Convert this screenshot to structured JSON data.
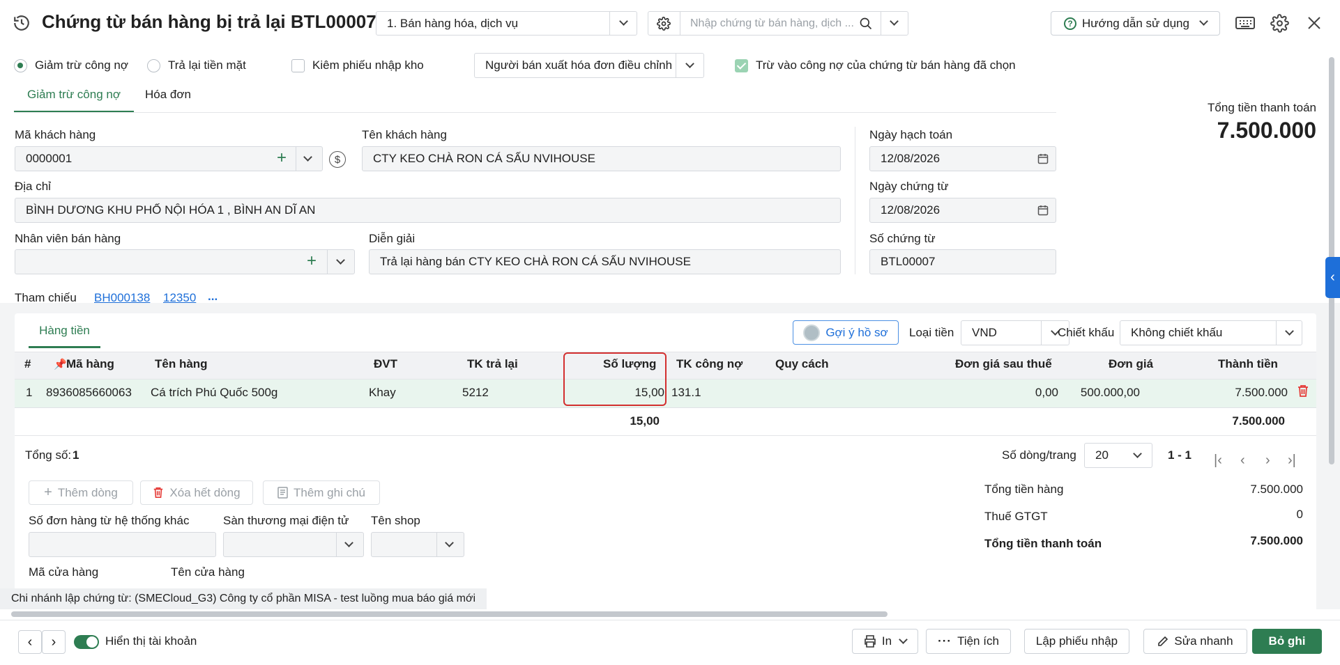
{
  "header": {
    "title": "Chứng từ bán hàng bị trả lại BTL00007",
    "type_select": "1. Bán hàng hóa, dịch vụ",
    "search_placeholder": "Nhập chứng từ bán hàng, dịch ...",
    "help_label": "Hướng dẫn sử dụng"
  },
  "options": {
    "radio_deduct": "Giảm trừ công nợ",
    "radio_refund": "Trả lại tiền mặt",
    "check_stock": "Kiêm phiếu nhập kho",
    "invoice_select": "Người bán xuất hóa đơn điều chỉnh",
    "check_offset": "Trừ vào công nợ của chứng từ bán hàng đã chọn"
  },
  "tabs": [
    "Giảm trừ công nợ",
    "Hóa đơn"
  ],
  "total_box": {
    "label": "Tổng tiền thanh toán",
    "value": "7.500.000"
  },
  "form": {
    "customer_code_label": "Mã khách hàng",
    "customer_code": "0000001",
    "customer_name_label": "Tên khách hàng",
    "customer_name": "CTY KEO CHÀ RON  CÁ SẤU NVIHOUSE",
    "address_label": "Địa chỉ",
    "address": "BÌNH DƯƠNG KHU PHỐ NỘI HÓA 1 , BÌNH AN DĨ AN",
    "sales_staff_label": "Nhân viên bán hàng",
    "sales_staff": "",
    "description_label": "Diễn giải",
    "description": "Trả lại hàng bán CTY KEO CHÀ RON  CÁ SẤU NVIHOUSE",
    "posting_date_label": "Ngày hạch toán",
    "posting_date": "12/08/2026",
    "voucher_date_label": "Ngày chứng từ",
    "voucher_date": "12/08/2026",
    "voucher_no_label": "Số chứng từ",
    "voucher_no": "BTL00007",
    "reference_label": "Tham chiếu",
    "ref1": "BH000138",
    "ref2": "12350",
    "ref_more": "..."
  },
  "goods": {
    "tab": "Hàng tiền",
    "suggest_btn": "Gợi ý hồ sơ",
    "currency_label": "Loại tiền",
    "currency": "VND",
    "discount_label": "Chiết khấu",
    "discount": "Không chiết khấu",
    "columns": [
      "#",
      "Mã hàng",
      "Tên hàng",
      "ĐVT",
      "TK trả lại",
      "Số lượng",
      "TK công nợ",
      "Quy cách",
      "Đơn giá sau thuế",
      "Đơn giá",
      "Thành tiền"
    ],
    "rows": [
      {
        "no": "1",
        "code": "8936085660063",
        "name": "Cá trích Phú Quốc 500g",
        "unit": "Khay",
        "return_acc": "5212",
        "qty": "15,00",
        "debt_acc": "131.1",
        "spec": "",
        "price_after_tax": "0,00",
        "price": "500.000,00",
        "amount": "7.500.000"
      }
    ],
    "total_qty": "15,00",
    "total_amount": "7.500.000",
    "count_label": "Tổng số:",
    "count": "1",
    "rows_per_page_label": "Số dòng/trang",
    "rows_per_page": "20",
    "page_range": "1 - 1"
  },
  "actions": {
    "add_row": "Thêm dòng",
    "delete_all": "Xóa hết dòng",
    "add_note": "Thêm ghi chú"
  },
  "extra": {
    "order_no_label": "Số đơn hàng từ hệ thống khác",
    "ecommerce_label": "Sàn thương mại điện tử",
    "shop_name_label": "Tên shop",
    "store_code_label": "Mã cửa hàng",
    "store_name_label": "Tên cửa hàng"
  },
  "summary": {
    "goods_total_label": "Tổng tiền hàng",
    "goods_total": "7.500.000",
    "vat_label": "Thuế GTGT",
    "vat": "0",
    "pay_total_label": "Tổng tiền thanh toán",
    "pay_total": "7.500.000"
  },
  "branch_note": "Chi nhánh lập chứng từ: (SMECloud_G3) Công ty cổ phần MISA - test luồng mua báo giá mới",
  "footer": {
    "show_account": "Hiển thị tài khoản",
    "print": "In",
    "utilities": "Tiện ích",
    "create_receipt": "Lập phiếu nhập",
    "quick_edit": "Sửa nhanh",
    "unpost": "Bỏ ghi"
  },
  "colors": {
    "accent": "#2e7d52",
    "link": "#1e6fd9",
    "highlight_row": "#e9f5ee",
    "danger": "#e53935"
  }
}
